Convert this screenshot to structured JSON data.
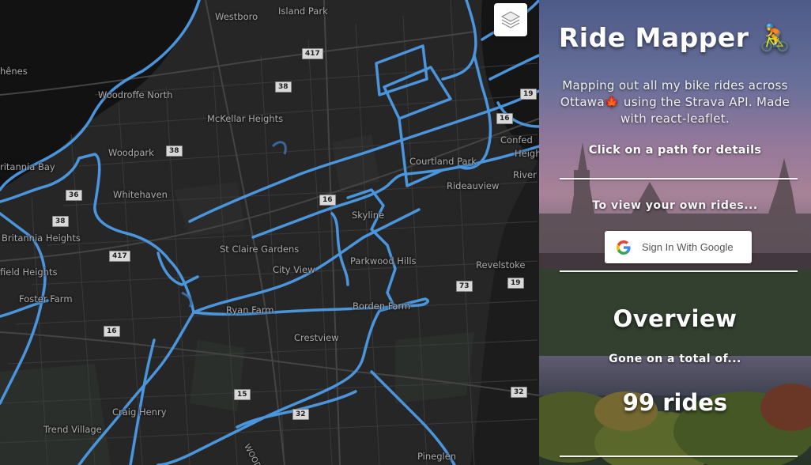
{
  "map": {
    "layers_button": "layers-icon",
    "places": [
      {
        "label": "Westboro",
        "cls": "p1"
      },
      {
        "label": "Island Park",
        "cls": "p2"
      },
      {
        "label": "hênes",
        "cls": "p3"
      },
      {
        "label": "Woodroffe North",
        "cls": "p4"
      },
      {
        "label": "McKellar Heights",
        "cls": "p5"
      },
      {
        "label": "Woodpark",
        "cls": "p6"
      },
      {
        "label": "ritannia Bay",
        "cls": "p7"
      },
      {
        "label": "Whitehaven",
        "cls": "p8"
      },
      {
        "label": "Britannia Heights",
        "cls": "p9"
      },
      {
        "label": "field Heights",
        "cls": "p10"
      },
      {
        "label": "Foster Farm",
        "cls": "p11"
      },
      {
        "label": "St Claire Gardens",
        "cls": "p12"
      },
      {
        "label": "City View",
        "cls": "p13"
      },
      {
        "label": "Ryan Farm",
        "cls": "p14"
      },
      {
        "label": "Skyline",
        "cls": "p15"
      },
      {
        "label": "Parkwood Hills",
        "cls": "p16"
      },
      {
        "label": "Borden Farm",
        "cls": "p17"
      },
      {
        "label": "Crestview",
        "cls": "p18"
      },
      {
        "label": "Courtland Park",
        "cls": "p19"
      },
      {
        "label": "Rideauview",
        "cls": "p20"
      },
      {
        "label": "Revelstoke",
        "cls": "p21"
      },
      {
        "label": "Confed",
        "cls": "p22"
      },
      {
        "label": "Heigh",
        "cls": "p23"
      },
      {
        "label": "River",
        "cls": "p24"
      },
      {
        "label": "Craig Henry",
        "cls": "p25"
      },
      {
        "label": "Trend Village",
        "cls": "p26"
      },
      {
        "label": "Pineglen",
        "cls": "p27"
      },
      {
        "label": "WOODRO",
        "cls": "p28"
      }
    ],
    "shields": [
      {
        "label": "417"
      },
      {
        "label": "38"
      },
      {
        "label": "38"
      },
      {
        "label": "36"
      },
      {
        "label": "38"
      },
      {
        "label": "417"
      },
      {
        "label": "16"
      },
      {
        "label": "16"
      },
      {
        "label": "73"
      },
      {
        "label": "19"
      },
      {
        "label": "15"
      },
      {
        "label": "32"
      },
      {
        "label": "32"
      },
      {
        "label": "16"
      },
      {
        "label": "19"
      }
    ]
  },
  "panel": {
    "title": "Ride Mapper 🚴",
    "description": "Mapping out all my bike rides across Ottawa🍁 using the Strava API. Made with react-leaflet.",
    "click_hint": "Click on a path for details",
    "view_own": "To view your own rides...",
    "google_button": "Sign In With Google",
    "overview_heading": "Overview",
    "gone_total": "Gone on a total of...",
    "rides_count": "99 rides"
  }
}
